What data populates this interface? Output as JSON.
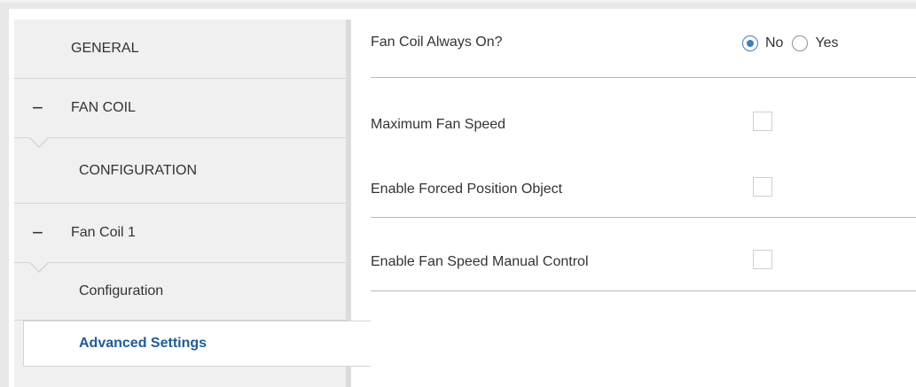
{
  "sidebar": {
    "items": [
      {
        "label": "GENERAL",
        "type": "section"
      },
      {
        "label": "FAN COIL",
        "type": "group",
        "expanded": true,
        "toggle_icon": "minus-icon"
      },
      {
        "label": "CONFIGURATION",
        "type": "section"
      },
      {
        "label": "Fan Coil 1",
        "type": "group",
        "expanded": true,
        "toggle_icon": "minus-icon"
      },
      {
        "label": "Configuration",
        "type": "page"
      },
      {
        "label": "Advanced Settings",
        "type": "page",
        "selected": true
      }
    ]
  },
  "main": {
    "rows": [
      {
        "label": "Fan Coil Always On?",
        "control": "radio",
        "options": [
          {
            "label": "No",
            "checked": true
          },
          {
            "label": "Yes",
            "checked": false
          }
        ]
      },
      {
        "label": "Maximum Fan Speed",
        "control": "checkbox",
        "checked": false
      },
      {
        "label": "Enable Forced Position Object",
        "control": "checkbox",
        "checked": false
      },
      {
        "label": "Enable Fan Speed Manual Control",
        "control": "checkbox",
        "checked": false
      }
    ]
  },
  "colors": {
    "selected_text": "#1f5b9a",
    "radio_accent": "#3c7fc0",
    "sidebar_bg": "#f0f0f0"
  }
}
